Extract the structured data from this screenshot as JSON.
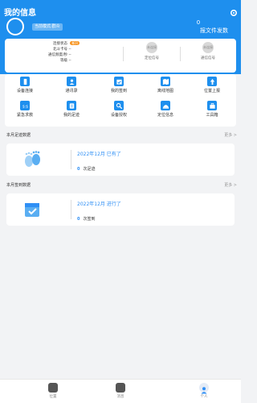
{
  "header": {
    "title": "我的信息",
    "mode_badge": "当前模式:群众",
    "count": "0",
    "count_label": "报文件发数"
  },
  "status": {
    "rows": [
      {
        "key": "连接状态",
        "value": "",
        "tag": "断开"
      },
      {
        "key": "北斗卡号",
        "value": "--"
      },
      {
        "key": "通信频度/秒",
        "value": "--"
      },
      {
        "key": "等级",
        "value": "--"
      }
    ],
    "stats": [
      {
        "circle": "未连接",
        "label": "定位信号"
      },
      {
        "circle": "未连接",
        "label": "通信信号"
      }
    ]
  },
  "grid": [
    {
      "label": "设备连接",
      "icon": "device-connect-icon",
      "color": "#1e8fee"
    },
    {
      "label": "通讯录",
      "icon": "contacts-icon",
      "color": "#1e8fee"
    },
    {
      "label": "我的签到",
      "icon": "checkin-icon",
      "color": "#1e8fee"
    },
    {
      "label": "离线地图",
      "icon": "offline-map-icon",
      "color": "#1e8fee"
    },
    {
      "label": "位置上报",
      "icon": "location-report-icon",
      "color": "#1e8fee"
    },
    {
      "label": "紧急求救",
      "icon": "sos-icon",
      "color": "#1e8fee"
    },
    {
      "label": "我的足迹",
      "icon": "footprint-icon",
      "color": "#1e8fee"
    },
    {
      "label": "设备授权",
      "icon": "device-auth-icon",
      "color": "#1e8fee"
    },
    {
      "label": "定位信息",
      "icon": "position-info-icon",
      "color": "#1e8fee"
    },
    {
      "label": "工具箱",
      "icon": "toolbox-icon",
      "color": "#1e8fee"
    }
  ],
  "footprint": {
    "title": "本月足迹数据",
    "more": "更多 >",
    "date": "2022年12月 已有了",
    "number": "0",
    "unit": "次足迹"
  },
  "signin": {
    "title": "本月签到数据",
    "more": "更多 >",
    "date": "2022年12月 进行了",
    "number": "0",
    "unit": "次签到"
  },
  "tabs": [
    {
      "label": "位置",
      "icon": "location-icon"
    },
    {
      "label": "消息",
      "icon": "message-icon"
    },
    {
      "label": "个人",
      "icon": "person-icon"
    }
  ],
  "colors": {
    "accent": "#1e8fee",
    "link": "#2f8ff5",
    "tag": "#f7931e"
  }
}
